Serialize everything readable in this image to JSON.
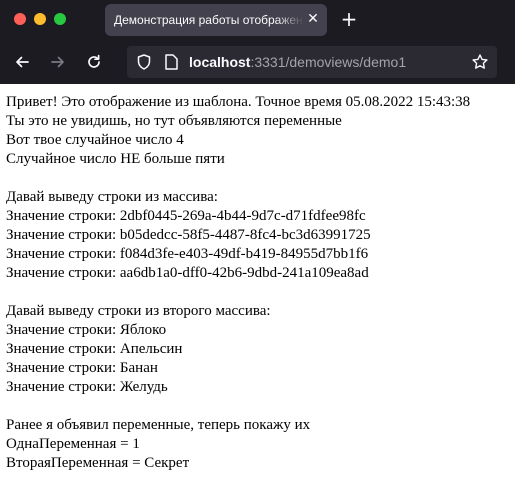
{
  "browser": {
    "tab_title": "Демонстрация работы отображения",
    "tab_close": "✕",
    "new_tab": "+",
    "url_host": "localhost",
    "url_rest": ":3331/demoviews/demo1",
    "icons": [
      "back-arrow-icon",
      "forward-arrow-icon",
      "reload-icon",
      "shield-icon",
      "page-icon",
      "star-icon"
    ]
  },
  "page": {
    "line1": "Привет! Это отображение из шаблона. Точное время 05.08.2022 15:43:38",
    "line2": "Ты это не увидишь, но тут объявляются переменные",
    "line3": "Вот твое случайное число 4",
    "line4": "Случайное число НЕ больше пяти",
    "array1_header": "Давай выведу строки из массива:",
    "array1": [
      "Значение строки: 2dbf0445-269a-4b44-9d7c-d71fdfee98fc",
      "Значение строки: b05dedcc-58f5-4487-8fc4-bc3d63991725",
      "Значение строки: f084d3fe-e403-49df-b419-84955d7bb1f6",
      "Значение строки: aa6db1a0-dff0-42b6-9dbd-241a109ea8ad"
    ],
    "array2_header": "Давай выведу строки из второго массива:",
    "array2": [
      "Значение строки: Яблоко",
      "Значение строки: Апельсин",
      "Значение строки: Банан",
      "Значение строки: Желудь"
    ],
    "vars_header": "Ранее я объявил переменные, теперь покажу их",
    "var1": "ОднаПеременная = 1",
    "var2": "ВтораяПеременная = Секрет"
  }
}
